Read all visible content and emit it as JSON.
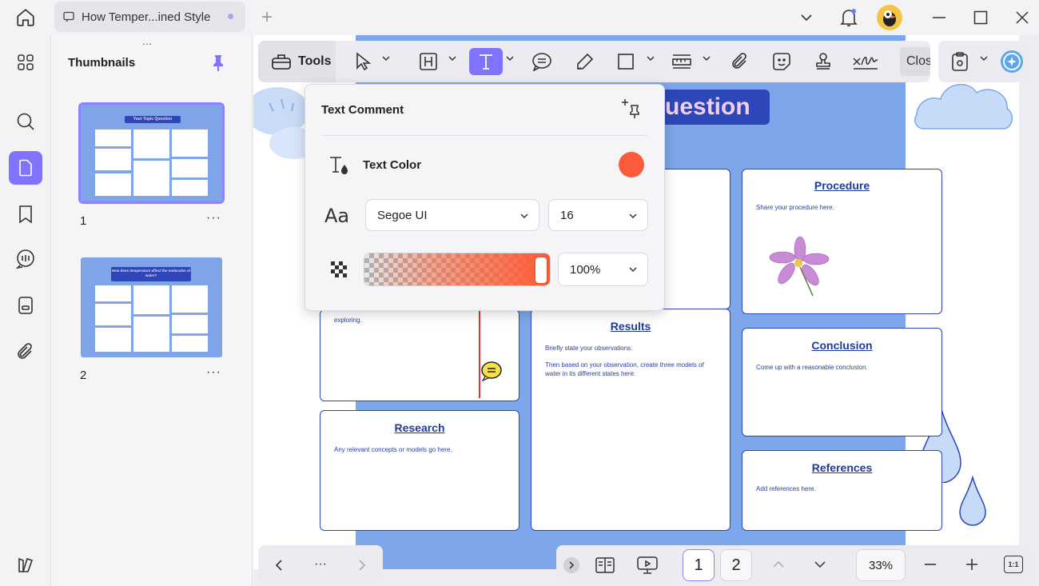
{
  "tab": {
    "title": "How Temper...ined Style",
    "new_tab": "+"
  },
  "sidebar": {
    "title": "Thumbnails"
  },
  "thumbnails": [
    {
      "number": "1",
      "more": "···",
      "heading": "Your Topic Question"
    },
    {
      "number": "2",
      "more": "···",
      "heading": "How does temperature affect the molecules of water?"
    }
  ],
  "toolbar": {
    "tools_label": "Tools",
    "close_label": "Clos"
  },
  "popup": {
    "title": "Text Comment",
    "text_color_label": "Text Color",
    "text_color": "#fb5b3b",
    "font_family": "Segoe UI",
    "font_size": "16",
    "opacity": "100%"
  },
  "document": {
    "title_fragment": "uestion",
    "cards": {
      "procedure": {
        "heading": "Procedure",
        "text": "Share your procedure here."
      },
      "results": {
        "heading": "Results",
        "text1": "Briefly state your observations.",
        "text2": "Then based on your observation, create three models of water in its different states here."
      },
      "conclusion": {
        "heading": "Conclusion",
        "text": "Come up with a reasonable conclusion."
      },
      "research": {
        "heading": "Research",
        "text": "Any relevant concepts or models go here."
      },
      "references": {
        "heading": "References",
        "text": "Add references here."
      },
      "hypothesis": {
        "text": "Write your proposed explanation for the idea you're exploring.",
        "text_visible": "exploring."
      }
    }
  },
  "bottom_nav": {
    "more": "···",
    "page1": "1",
    "page2": "2",
    "zoom": "33%",
    "fit": "1:1"
  },
  "colors": {
    "accent": "#7f73ff",
    "page_blue": "#7ea6ea",
    "card_border": "#2d47b8"
  }
}
